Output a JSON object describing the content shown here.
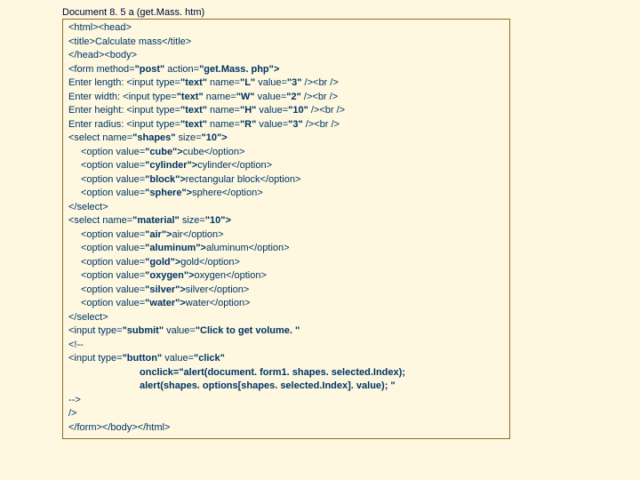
{
  "title": "Document 8. 5 a (get.Mass. htm)",
  "lines": {
    "l1": "<html><head>",
    "l2": "<title>Calculate mass</title>",
    "l3": "</head><body>",
    "l4a": "<form method=",
    "l4b": "\"post\"",
    "l4c": " action=",
    "l4d": "\"get.Mass. php\">",
    "l5a": "Enter length: <input type=",
    "l5b": "\"text\"",
    "l5c": " name=",
    "l5d": "\"L\"",
    "l5e": " value=",
    "l5f": "\"3\"",
    "l5g": " /><br />",
    "l6a": "Enter width: <input type=",
    "l6d": "\"W\"",
    "l6f": "\"2\"",
    "l7a": "Enter height: <input type=",
    "l7d": "\"H\"",
    "l7f": "\"10\"",
    "l8a": "Enter radius: <input type=",
    "l8d": "\"R\"",
    "l8f": "\"3\"",
    "l9a": "<select name=",
    "l9b": "\"shapes\"",
    "l9c": " size=",
    "l9d": "\"10\">",
    "l10a": "<option value=",
    "l10b": "\"cube\">",
    "l10c": "cube</option>",
    "l11b": "\"cylinder\">",
    "l11c": "cylinder</option>",
    "l12b": "\"block\">",
    "l12c": "rectangular block</option>",
    "l13b": "\"sphere\">",
    "l13c": "sphere</option>",
    "l14": "</select>",
    "l15b": "\"material\"",
    "l16b": "\"air\">",
    "l16c": "air</option>",
    "l17b": "\"aluminum\">",
    "l17c": "aluminum</option>",
    "l18b": "\"gold\">",
    "l18c": "gold</option>",
    "l19b": "\"oxygen\">",
    "l19c": "oxygen</option>",
    "l20b": "\"silver\">",
    "l20c": "silver</option>",
    "l21b": "\"water\">",
    "l21c": "water</option>",
    "l22a": "<input type=",
    "l22b": "\"submit\"",
    "l22c": " value=",
    "l22d": "\"Click to get volume. \"",
    "l23": "<!--",
    "l24a": "<input type=",
    "l24b": "\"button\"",
    "l24c": " value=",
    "l24d": "\"click\"",
    "l25": "onclick=\"alert(document. form1. shapes. selected.Index);",
    "l26": "alert(shapes. options[shapes. selected.Index]. value); \"",
    "l27": "-->",
    "l28": "/>",
    "l29": "</form></body></html>"
  }
}
